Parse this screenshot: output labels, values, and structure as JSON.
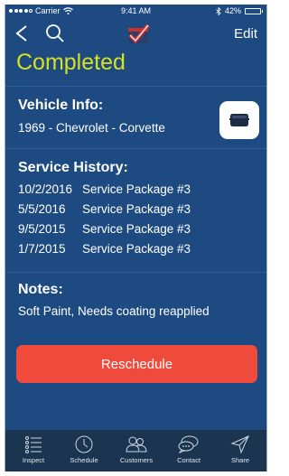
{
  "status_bar": {
    "carrier": "Carrier",
    "time": "9:41 AM",
    "battery": "42%",
    "battery_level": 0.42,
    "signal_bars_filled": 4,
    "signal_bars_total": 5,
    "icons": [
      "signal-dots-icon",
      "wifi-icon",
      "bluetooth-icon",
      "battery-icon"
    ]
  },
  "nav": {
    "back_icon": "chevron-left-icon",
    "search_icon": "search-icon",
    "logo_icon": "checkmark-logo-icon",
    "edit_label": "Edit"
  },
  "job_status": "Completed",
  "vehicle": {
    "title": "Vehicle Info:",
    "description": "1969 - Chevrolet - Corvette",
    "button_icon": "vehicle-icon"
  },
  "service_history": {
    "title": "Service History:",
    "entries": [
      {
        "date": "10/2/2016",
        "service": "Service Package #3"
      },
      {
        "date": "5/5/2016",
        "service": "Service Package #3"
      },
      {
        "date": "9/5/2015",
        "service": "Service Package #3"
      },
      {
        "date": "1/7/2015",
        "service": "Service Package #3"
      }
    ]
  },
  "notes": {
    "title": "Notes:",
    "text": "Soft Paint, Needs coating reapplied"
  },
  "reschedule_label": "Reschedule",
  "tabs": [
    {
      "label": "Inspect",
      "icon": "list-icon"
    },
    {
      "label": "Schedule",
      "icon": "clock-icon"
    },
    {
      "label": "Customers",
      "icon": "people-icon"
    },
    {
      "label": "Contact",
      "icon": "chat-bubble-icon"
    },
    {
      "label": "Share",
      "icon": "send-icon"
    }
  ],
  "colors": {
    "background": "#1e4a82",
    "status_accent": "#d8e022",
    "reschedule": "#f04a3c",
    "tab_bar": "#1b3450"
  }
}
